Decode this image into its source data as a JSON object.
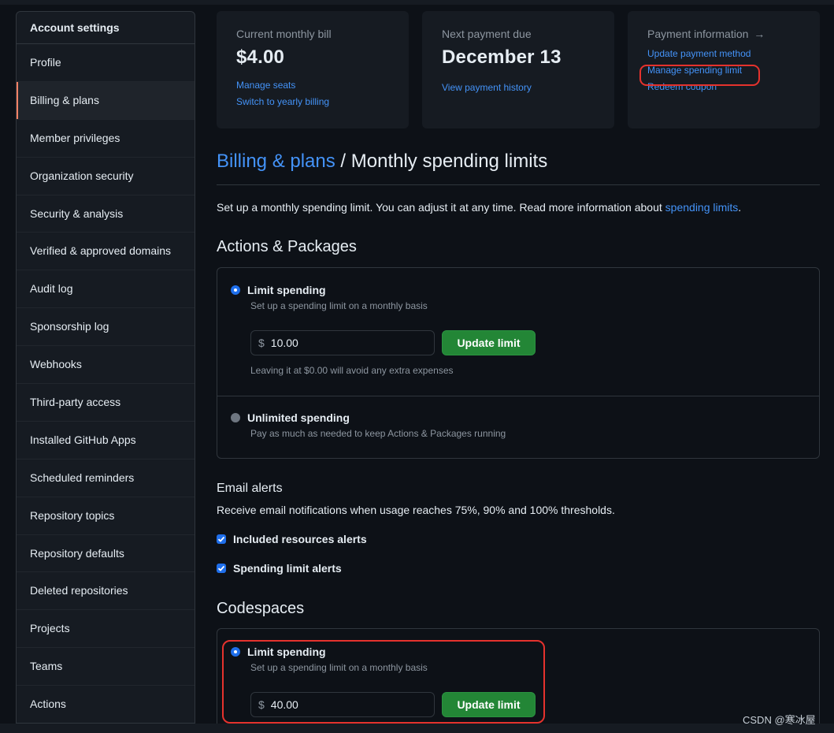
{
  "sidebar": {
    "header": "Account settings",
    "items": [
      {
        "label": "Profile"
      },
      {
        "label": "Billing & plans"
      },
      {
        "label": "Member privileges"
      },
      {
        "label": "Organization security"
      },
      {
        "label": "Security & analysis"
      },
      {
        "label": "Verified & approved domains"
      },
      {
        "label": "Audit log"
      },
      {
        "label": "Sponsorship log"
      },
      {
        "label": "Webhooks"
      },
      {
        "label": "Third-party access"
      },
      {
        "label": "Installed GitHub Apps"
      },
      {
        "label": "Scheduled reminders"
      },
      {
        "label": "Repository topics"
      },
      {
        "label": "Repository defaults"
      },
      {
        "label": "Deleted repositories"
      },
      {
        "label": "Projects"
      },
      {
        "label": "Teams"
      },
      {
        "label": "Actions"
      }
    ],
    "active_item": "Billing & plans"
  },
  "cards": {
    "bill": {
      "title": "Current monthly bill",
      "amount": "$4.00",
      "links": [
        "Manage seats",
        "Switch to yearly billing"
      ]
    },
    "next_payment": {
      "title": "Next payment due",
      "date": "December 13",
      "links": [
        "View payment history"
      ]
    },
    "payment_info": {
      "title": "Payment information",
      "arrow_icon": "arrow-right-icon",
      "links": [
        "Update payment method",
        "Manage spending limit",
        "Redeem coupon"
      ]
    }
  },
  "page": {
    "breadcrumb_link": "Billing & plans",
    "separator": "/",
    "title": "Monthly spending limits",
    "intro": "Set up a monthly spending limit. You can adjust it at any time. Read more information about",
    "intro_link": "spending limits",
    "intro_end": "."
  },
  "actions_packages": {
    "title": "Actions & Packages",
    "limit_option": {
      "title": "Limit spending",
      "desc": "Set up a spending limit on a monthly basis",
      "selected": true
    },
    "currency": "$",
    "amount": "10.00",
    "update_button": "Update limit",
    "note": "Leaving it at $0.00 will avoid any extra expenses",
    "unlimited_option": {
      "title": "Unlimited spending",
      "desc": "Pay as much as needed to keep Actions & Packages running",
      "selected": false
    }
  },
  "email_alerts": {
    "title": "Email alerts",
    "desc": "Receive email notifications when usage reaches 75%, 90% and 100% thresholds.",
    "checkboxes": [
      {
        "label": "Included resources alerts",
        "checked": true
      },
      {
        "label": "Spending limit alerts",
        "checked": true
      }
    ]
  },
  "codespaces": {
    "title": "Codespaces",
    "limit_option": {
      "title": "Limit spending",
      "desc": "Set up a spending limit on a monthly basis",
      "selected": true
    },
    "currency": "$",
    "amount": "40.00",
    "update_button": "Update limit"
  },
  "watermark": "CSDN @寒冰屋",
  "colors": {
    "background": "#0d1117",
    "surface": "#161b22",
    "border": "#30363d",
    "link": "#4493f8",
    "accent_active": "#f78166",
    "button_green": "#238636",
    "highlight_red": "#e5322d"
  }
}
